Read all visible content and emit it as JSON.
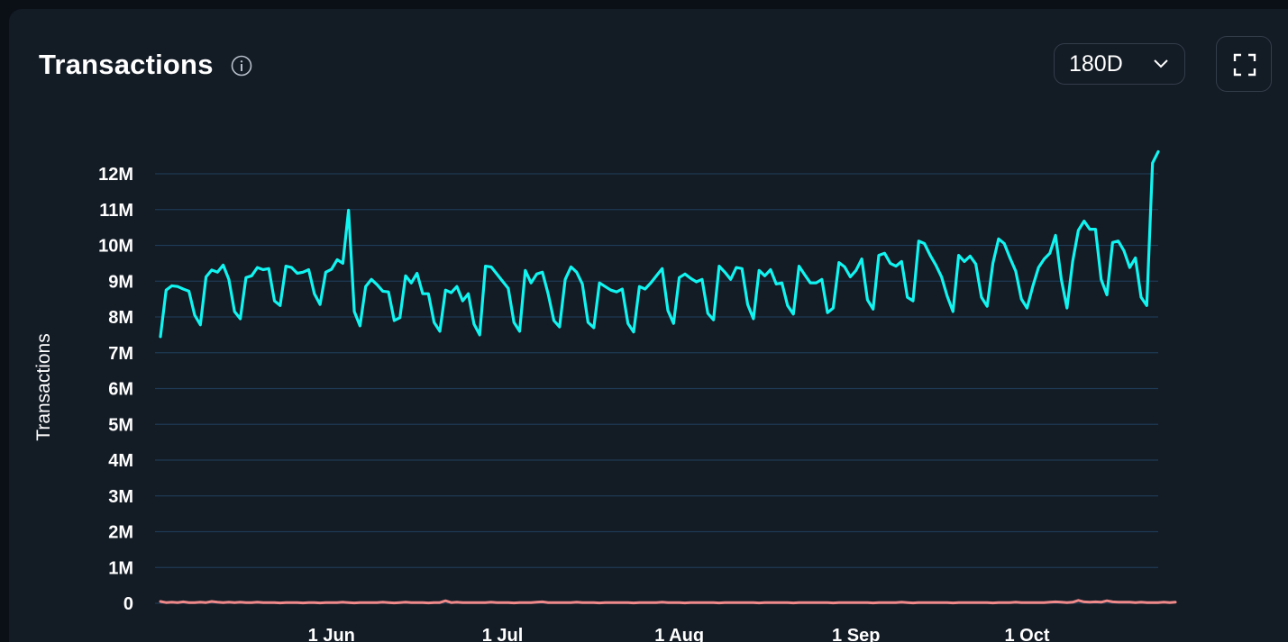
{
  "header": {
    "title": "Transactions",
    "range_label": "180D"
  },
  "icons": {
    "info": "info-icon",
    "dropdown": "chevron-down-icon",
    "fullscreen": "fullscreen-icon"
  },
  "colors": {
    "background": "#131b25",
    "grid": "#1e3a55",
    "series_main": "#12f4f0",
    "series_secondary": "#f08a8a"
  },
  "chart_data": {
    "type": "line",
    "ylabel": "Transactions",
    "ylim": [
      0,
      12000000
    ],
    "yticks": [
      0,
      1000000,
      2000000,
      3000000,
      4000000,
      5000000,
      6000000,
      7000000,
      8000000,
      9000000,
      10000000,
      11000000,
      12000000
    ],
    "ytick_labels": [
      "0",
      "1M",
      "2M",
      "3M",
      "4M",
      "5M",
      "6M",
      "7M",
      "8M",
      "9M",
      "10M",
      "11M",
      "12M"
    ],
    "xticks": [
      "2024-06-01",
      "2024-07-01",
      "2024-08-01",
      "2024-09-01",
      "2024-10-01"
    ],
    "xtick_labels": [
      "1 Jun",
      "1 Jul",
      "1 Aug",
      "1 Sep",
      "1 Oct"
    ],
    "x_start": "2024-05-02",
    "grid": true,
    "legend": "none",
    "series": [
      {
        "values": [
          7.45,
          8.75,
          8.87,
          8.85,
          8.78,
          8.72,
          8.05,
          7.78,
          9.12,
          9.31,
          9.25,
          9.45,
          9.05,
          8.15,
          7.95,
          9.1,
          9.15,
          9.38,
          9.32,
          9.35,
          8.45,
          8.32,
          9.42,
          9.38,
          9.22,
          9.25,
          9.32,
          8.65,
          8.35,
          9.25,
          9.33,
          9.6,
          9.5,
          10.98,
          8.15,
          7.75,
          8.85,
          9.05,
          8.9,
          8.72,
          8.7,
          7.9,
          7.98,
          9.15,
          8.95,
          9.22,
          8.65,
          8.65,
          7.85,
          7.6,
          8.75,
          8.68,
          8.85,
          8.45,
          8.65,
          7.8,
          7.5,
          9.42,
          9.4,
          9.2,
          9.0,
          8.8,
          7.85,
          7.6,
          9.3,
          8.95,
          9.2,
          9.25,
          8.65,
          7.9,
          7.72,
          9.05,
          9.4,
          9.25,
          8.92,
          7.85,
          7.7,
          8.95,
          8.85,
          8.75,
          8.7,
          8.78,
          7.82,
          7.58,
          8.85,
          8.78,
          8.95,
          9.15,
          9.35,
          8.18,
          7.82,
          9.1,
          9.2,
          9.08,
          8.98,
          9.05,
          8.1,
          7.92,
          9.42,
          9.25,
          9.05,
          9.38,
          9.35,
          8.35,
          7.95,
          9.3,
          9.15,
          9.32,
          8.92,
          8.95,
          8.32,
          8.08,
          9.42,
          9.18,
          8.95,
          8.95,
          9.05,
          8.12,
          8.25,
          9.52,
          9.4,
          9.12,
          9.3,
          9.62,
          8.48,
          8.22,
          9.72,
          9.78,
          9.5,
          9.42,
          9.55,
          8.55,
          8.45,
          10.12,
          10.05,
          9.72,
          9.45,
          9.12,
          8.58,
          8.15,
          9.72,
          9.55,
          9.7,
          9.48,
          8.55,
          8.3,
          9.5,
          10.18,
          10.05,
          9.65,
          9.28,
          8.5,
          8.25,
          8.85,
          9.38,
          9.62,
          9.78,
          10.28,
          9.05,
          8.25,
          9.55,
          10.42,
          10.68,
          10.45,
          10.45,
          9.05,
          8.62,
          10.08,
          10.12,
          9.85,
          9.38,
          9.65,
          8.55,
          8.32,
          12.3,
          12.62
        ]
      },
      {
        "values": [
          0.05,
          0.02,
          0.03,
          0.02,
          0.04,
          0.02,
          0.02,
          0.03,
          0.02,
          0.05,
          0.03,
          0.02,
          0.03,
          0.02,
          0.03,
          0.02,
          0.02,
          0.03,
          0.02,
          0.02,
          0.02,
          0.01,
          0.02,
          0.02,
          0.02,
          0.01,
          0.02,
          0.02,
          0.01,
          0.02,
          0.02,
          0.02,
          0.03,
          0.02,
          0.01,
          0.02,
          0.02,
          0.02,
          0.02,
          0.03,
          0.02,
          0.01,
          0.02,
          0.03,
          0.02,
          0.02,
          0.02,
          0.01,
          0.02,
          0.02,
          0.07,
          0.02,
          0.03,
          0.02,
          0.02,
          0.02,
          0.02,
          0.02,
          0.03,
          0.02,
          0.02,
          0.02,
          0.01,
          0.02,
          0.02,
          0.02,
          0.03,
          0.04,
          0.02,
          0.02,
          0.02,
          0.02,
          0.02,
          0.03,
          0.02,
          0.02,
          0.02,
          0.01,
          0.02,
          0.02,
          0.02,
          0.02,
          0.02,
          0.01,
          0.02,
          0.02,
          0.02,
          0.02,
          0.03,
          0.02,
          0.02,
          0.02,
          0.01,
          0.02,
          0.02,
          0.02,
          0.02,
          0.02,
          0.01,
          0.02,
          0.02,
          0.02,
          0.02,
          0.02,
          0.02,
          0.01,
          0.02,
          0.02,
          0.02,
          0.02,
          0.02,
          0.01,
          0.02,
          0.02,
          0.02,
          0.02,
          0.02,
          0.02,
          0.01,
          0.02,
          0.02,
          0.02,
          0.02,
          0.02,
          0.02,
          0.01,
          0.02,
          0.02,
          0.02,
          0.02,
          0.03,
          0.02,
          0.01,
          0.02,
          0.02,
          0.02,
          0.02,
          0.02,
          0.02,
          0.01,
          0.02,
          0.02,
          0.02,
          0.02,
          0.02,
          0.02,
          0.01,
          0.02,
          0.02,
          0.02,
          0.03,
          0.02,
          0.02,
          0.02,
          0.02,
          0.02,
          0.03,
          0.04,
          0.03,
          0.02,
          0.03,
          0.08,
          0.04,
          0.03,
          0.04,
          0.03,
          0.07,
          0.04,
          0.03,
          0.03,
          0.03,
          0.02,
          0.03,
          0.02,
          0.02,
          0.02,
          0.03,
          0.02,
          0.03
        ]
      }
    ]
  }
}
